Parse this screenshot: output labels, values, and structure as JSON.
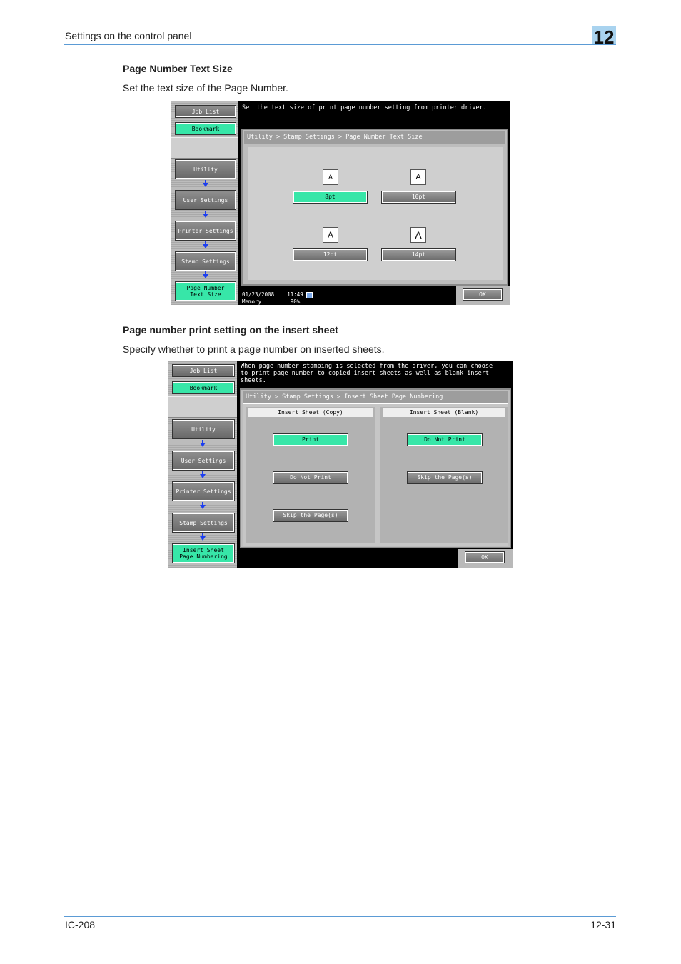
{
  "header": {
    "section_title": "Settings on the control panel",
    "chapter_number": "12"
  },
  "section1": {
    "heading": "Page Number Text Size",
    "description": "Set the text size of the Page Number.",
    "screen": {
      "sidebar": {
        "job_list": "Job List",
        "bookmark": "Bookmark",
        "nav": [
          "Utility",
          "User Settings",
          "Printer Settings",
          "Stamp Settings",
          "Page Number\nText Size"
        ]
      },
      "message": "Set the text size of print page number setting from printer driver.",
      "breadcrumb": "Utility > Stamp Settings > Page Number Text Size",
      "sample_glyph": "A",
      "options": [
        {
          "label": "8pt",
          "selected": true
        },
        {
          "label": "10pt",
          "selected": false
        },
        {
          "label": "12pt",
          "selected": false
        },
        {
          "label": "14pt",
          "selected": false
        }
      ],
      "status": {
        "date": "01/23/2008",
        "time": "11:49",
        "memory_label": "Memory",
        "memory_value": "90%"
      },
      "ok_label": "OK"
    }
  },
  "section2": {
    "heading": "Page number print setting on the insert sheet",
    "description": "Specify whether to print a page number on inserted sheets.",
    "screen": {
      "sidebar": {
        "job_list": "Job List",
        "bookmark": "Bookmark",
        "nav": [
          "Utility",
          "User Settings",
          "Printer Settings",
          "Stamp Settings",
          "Insert Sheet\nPage Numbering"
        ]
      },
      "message": "When page number stamping is selected from the driver, you can choose\nto print page number to copied insert sheets as well as blank insert sheets.",
      "breadcrumb": "Utility > Stamp Settings > Insert Sheet Page Numbering",
      "copy_column": {
        "title": "Insert Sheet (Copy)",
        "buttons": [
          {
            "label": "Print",
            "selected": true
          },
          {
            "label": "Do Not Print",
            "selected": false
          },
          {
            "label": "Skip the Page(s)",
            "selected": false
          }
        ]
      },
      "blank_column": {
        "title": "Insert Sheet (Blank)",
        "buttons": [
          {
            "label": "Do Not Print",
            "selected": true
          },
          {
            "label": "Skip the Page(s)",
            "selected": false
          }
        ]
      },
      "ok_label": "OK"
    }
  },
  "footer": {
    "model": "IC-208",
    "page": "12-31"
  },
  "colors": {
    "accent_line": "#5b9bd5",
    "chapter_tab": "#a9d3ef",
    "selected_button": "#37e6a8",
    "nav_arrow": "#1c3ef0"
  }
}
